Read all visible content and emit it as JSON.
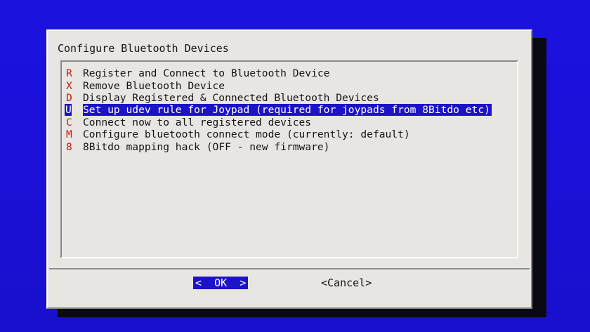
{
  "dialog": {
    "title": "Configure Bluetooth Devices"
  },
  "menu": {
    "items": [
      {
        "key": "R",
        "label": "Register and Connect to Bluetooth Device"
      },
      {
        "key": "X",
        "label": "Remove Bluetooth Device"
      },
      {
        "key": "D",
        "label": "Display Registered & Connected Bluetooth Devices"
      },
      {
        "key": "U",
        "label": "Set up udev rule for Joypad (required for joypads from 8Bitdo etc)"
      },
      {
        "key": "C",
        "label": "Connect now to all registered devices"
      },
      {
        "key": "M",
        "label": "Configure bluetooth connect mode (currently: default)"
      },
      {
        "key": "8",
        "label": "8Bitdo mapping hack (OFF - new firmware)"
      }
    ],
    "selected_key": "U"
  },
  "buttons": {
    "ok_label": "<  OK  >",
    "cancel_label": "<Cancel>"
  },
  "colors": {
    "background": "#1a10d8",
    "dialog": "#e8e6e2",
    "highlight": "#1c12c8",
    "hotkey": "#c41818"
  }
}
